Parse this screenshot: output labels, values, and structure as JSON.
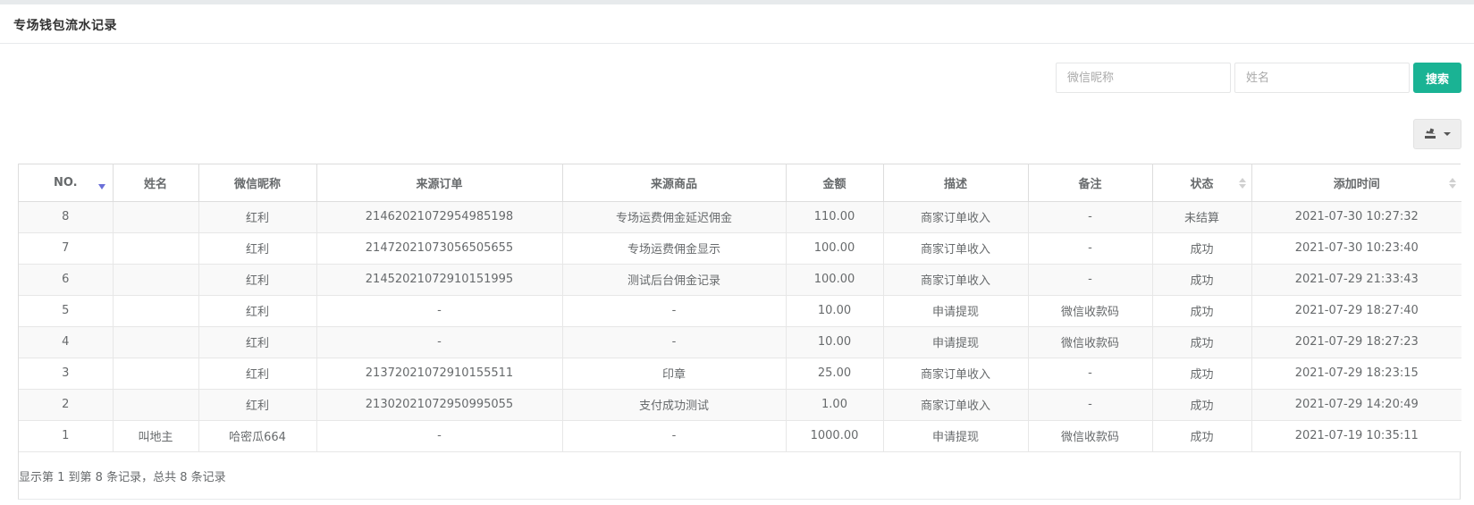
{
  "panel": {
    "title": "专场钱包流水记录"
  },
  "search": {
    "nickname_placeholder": "微信昵称",
    "name_placeholder": "姓名",
    "button_label": "搜索"
  },
  "toolbar": {
    "export_icon": "export-icon"
  },
  "table": {
    "headers": [
      "NO.",
      "姓名",
      "微信昵称",
      "来源订单",
      "来源商品",
      "金额",
      "描述",
      "备注",
      "状态",
      "添加时间"
    ],
    "rows": [
      [
        "8",
        "",
        "红利",
        "2146202107295498519​8",
        "专场运费佣金延迟佣金",
        "110.00",
        "商家订单收入",
        "-",
        "未结算",
        "2021-07-30 10:27:32"
      ],
      [
        "7",
        "",
        "红利",
        "21472021073056505655",
        "专场运费佣金显示",
        "100.00",
        "商家订单收入",
        "-",
        "成功",
        "2021-07-30 10:23:40"
      ],
      [
        "6",
        "",
        "红利",
        "21452021072910151995",
        "测试后台佣金记录",
        "100.00",
        "商家订单收入",
        "-",
        "成功",
        "2021-07-29 21:33:43"
      ],
      [
        "5",
        "",
        "红利",
        "-",
        "-",
        "10.00",
        "申请提现",
        "微信收款码",
        "成功",
        "2021-07-29 18:27:40"
      ],
      [
        "4",
        "",
        "红利",
        "-",
        "-",
        "10.00",
        "申请提现",
        "微信收款码",
        "成功",
        "2021-07-29 18:27:23"
      ],
      [
        "3",
        "",
        "红利",
        "21372021072910155511",
        "印章",
        "25.00",
        "商家订单收入",
        "-",
        "成功",
        "2021-07-29 18:23:15"
      ],
      [
        "2",
        "",
        "红利",
        "21302021072950995055",
        "支付成功测试",
        "1.00",
        "商家订单收入",
        "-",
        "成功",
        "2021-07-29 14:20:49"
      ],
      [
        "1",
        "叫地主",
        "哈密瓜664",
        "-",
        "-",
        "1000.00",
        "申请提现",
        "微信收款码",
        "成功",
        "2021-07-19 10:35:11"
      ]
    ]
  },
  "pagination": {
    "info": "显示第 1 到第 8 条记录，总共 8 条记录"
  },
  "colors": {
    "primary": "#1ab394",
    "sort_active": "#6a6fd8",
    "border": "#dddddd",
    "stripe": "#f9f9f9"
  }
}
